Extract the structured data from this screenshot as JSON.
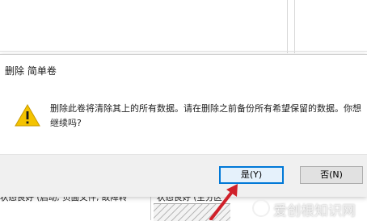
{
  "dialog": {
    "title": "删除 简单卷",
    "message": "删除此卷将清除其上的所有数据。请在删除之前备份所有希望保留的数据。你想继续吗?",
    "yes_label": "是(Y)",
    "no_label": "否(N)",
    "icon": "warning-icon"
  },
  "background": {
    "volume_status_1": "状态良好 (启动, 页面文件, 故障转",
    "volume_status_2": "状态良好 (主分区"
  },
  "watermark": {
    "text": "爱创根知识网"
  },
  "colors": {
    "accent": "#0078d7",
    "warning": "#f4c300",
    "arrow": "#d0202a",
    "button_bar": "#f0f0f0"
  }
}
